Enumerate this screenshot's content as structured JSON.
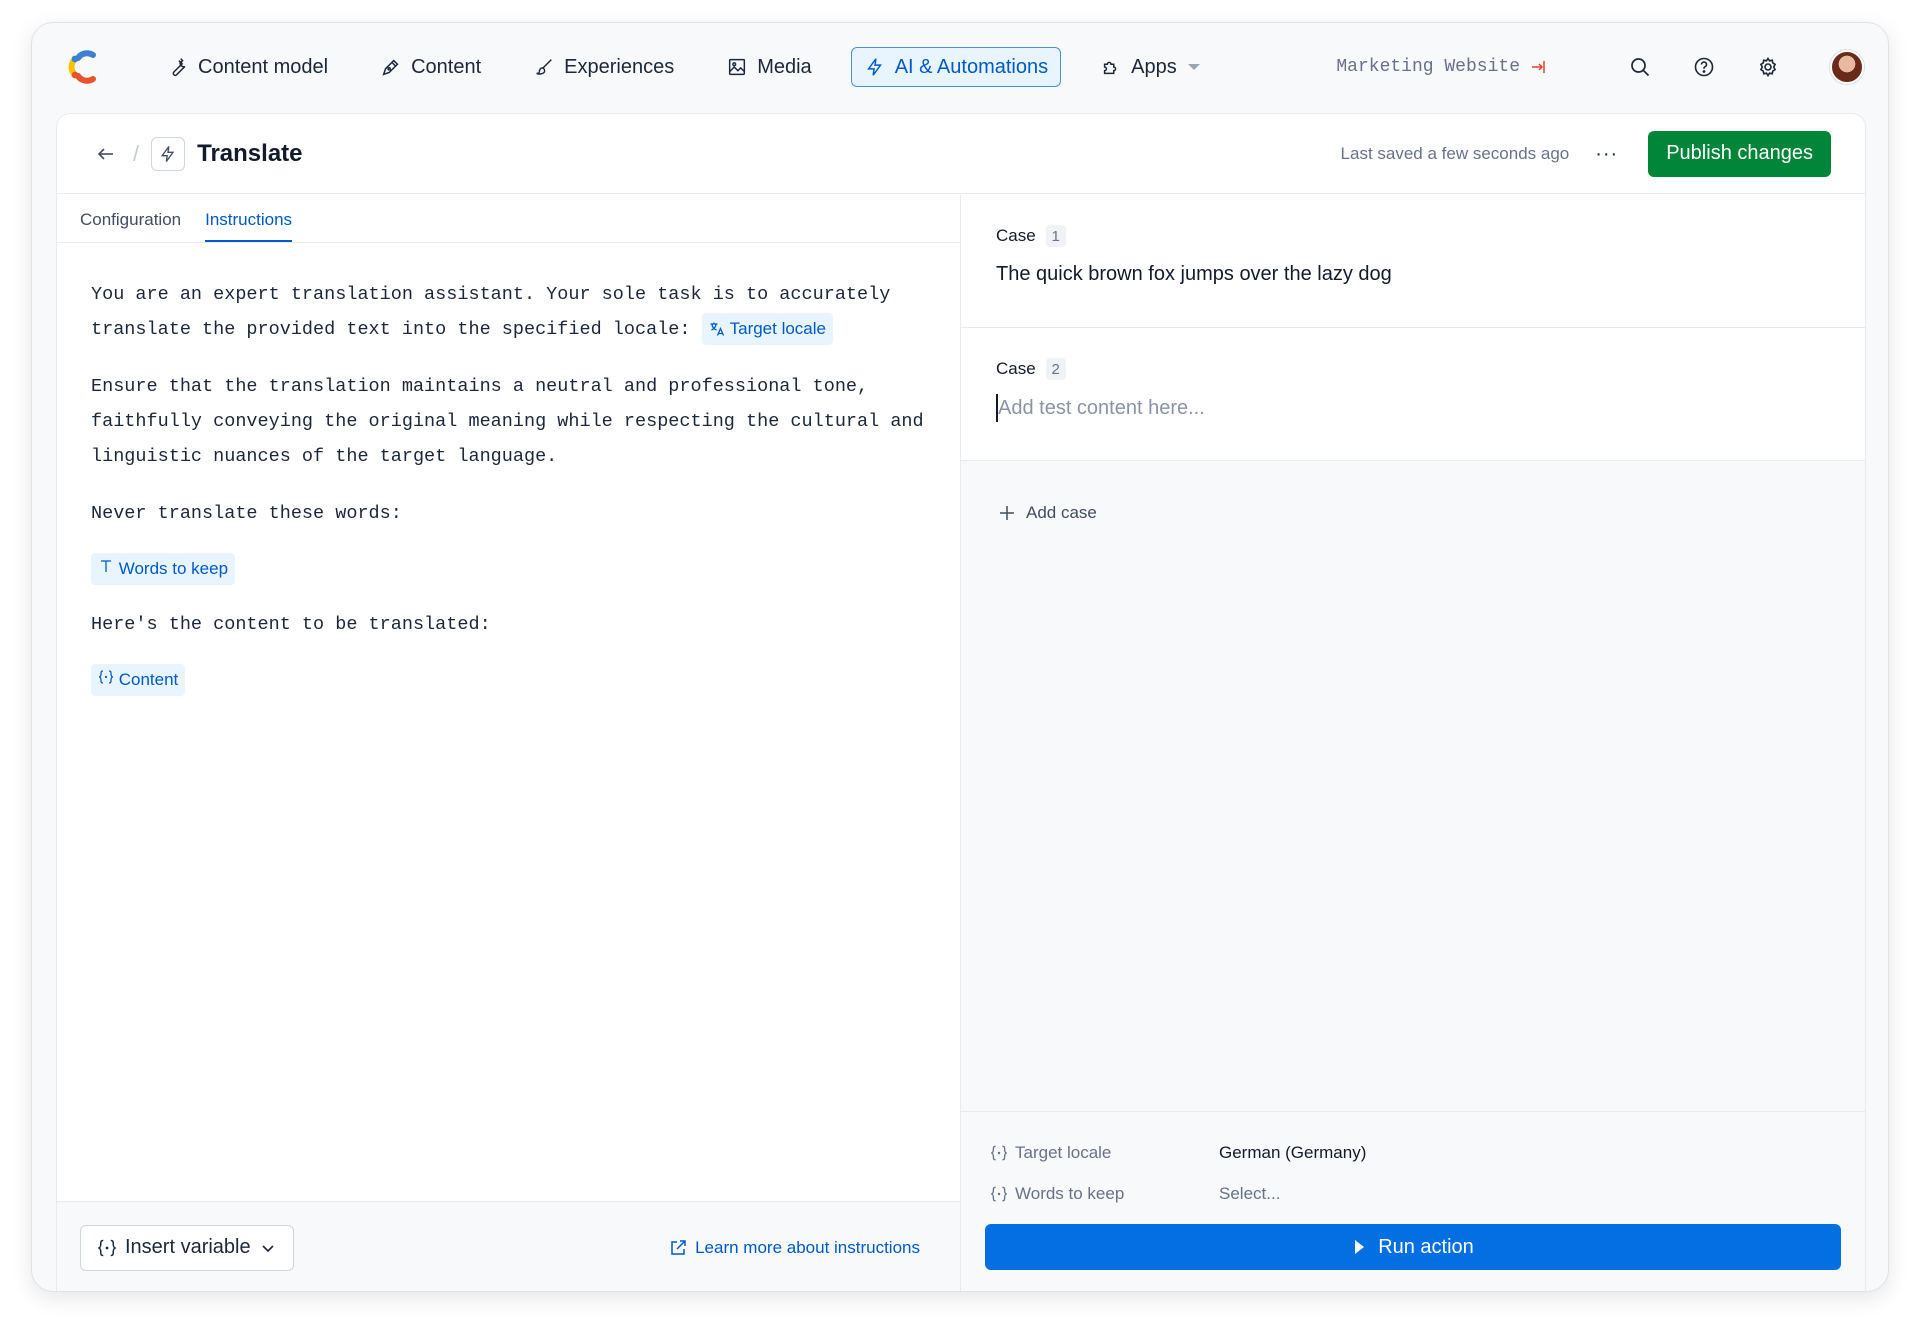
{
  "nav": {
    "items": [
      {
        "label": "Content model",
        "icon": "wrench-icon"
      },
      {
        "label": "Content",
        "icon": "pen-icon"
      },
      {
        "label": "Experiences",
        "icon": "brush-icon"
      },
      {
        "label": "Media",
        "icon": "image-icon"
      },
      {
        "label": "AI & Automations",
        "icon": "bolt-icon"
      },
      {
        "label": "Apps",
        "icon": "puzzle-icon"
      }
    ],
    "active": "AI & Automations",
    "space_name": "Marketing Website"
  },
  "header": {
    "title": "Translate",
    "saved_status": "Last saved a few seconds ago",
    "more": "···",
    "publish_label": "Publish changes"
  },
  "tabs": [
    "Configuration",
    "Instructions"
  ],
  "active_tab": "Instructions",
  "instructions": {
    "p1": "You are an expert translation assistant. Your sole task is to accurately translate the provided text into the specified locale:",
    "p1_chip": "Target locale",
    "p2": "Ensure that the translation maintains a neutral and professional tone, faithfully conveying the original meaning while respecting the cultural and linguistic nuances of the target language.",
    "p3": "Never translate these words:",
    "p3_chip": "Words to keep",
    "p4": "Here's the content to be translated:",
    "p4_chip": "Content"
  },
  "footer": {
    "insert_variable": "Insert variable",
    "learn_more": "Learn more about instructions"
  },
  "cases": [
    {
      "label": "Case",
      "number": "1",
      "text": "The quick brown fox jumps over the lazy dog"
    },
    {
      "label": "Case",
      "number": "2",
      "placeholder": "Add test content here..."
    }
  ],
  "add_case": "Add case",
  "variables": [
    {
      "name": "Target locale",
      "value": "German (Germany)"
    },
    {
      "name": "Words to keep",
      "value": "Select..."
    }
  ],
  "run_label": "Run action",
  "colors": {
    "accent": "#0059c8",
    "publish": "#008539",
    "run": "#036fe3"
  }
}
